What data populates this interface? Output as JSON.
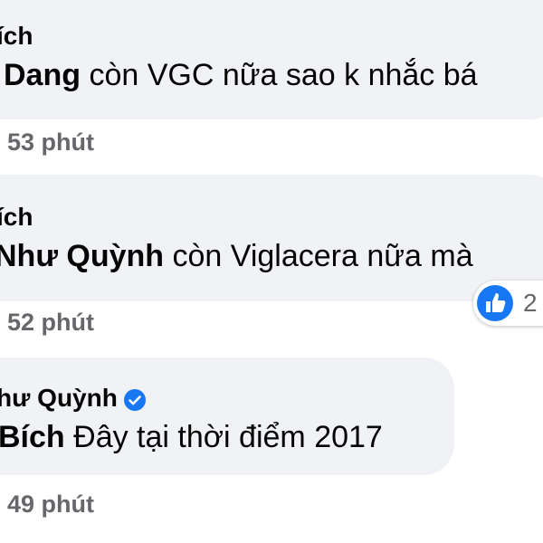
{
  "comments": [
    {
      "author": "ích",
      "mention": "Dang",
      "text": " còn VGC nữa sao k nhắc bá",
      "time": "53 phút"
    },
    {
      "author": "ích",
      "mention": "Như Quỳnh",
      "text": " còn Viglacera nữa mà",
      "time": "52 phút",
      "reaction": {
        "icon": "like-icon",
        "count": "2",
        "color": "#1877f2"
      }
    },
    {
      "author": "hư Quỳnh",
      "verified_icon": "verified-badge-icon",
      "mention": "Bích",
      "text": " Đây tại thời điểm 2017",
      "time": "49 phút"
    }
  ],
  "colors": {
    "bubble": "#f0f2f5",
    "meta_text": "#65676b",
    "accent": "#1877f2"
  }
}
